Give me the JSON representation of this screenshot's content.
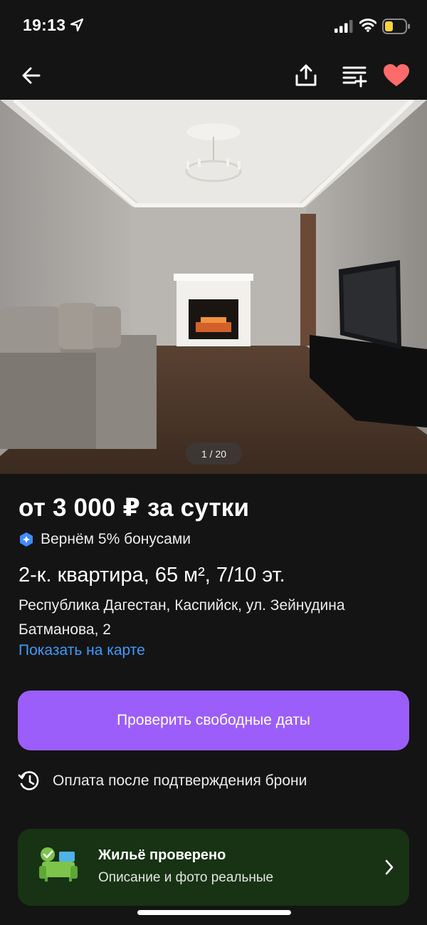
{
  "status": {
    "time": "19:13"
  },
  "gallery": {
    "counter": "1 / 20"
  },
  "listing": {
    "price": "от 3 000 ₽ за сутки",
    "bonus": "Вернём 5% бонусами",
    "title": "2-к. квартира, 65 м², 7/10 эт.",
    "address": "Республика Дагестан, Каспийск, ул. Зейнудина Батманова, 2",
    "map_link": "Показать на карте"
  },
  "cta": {
    "label": "Проверить свободные даты"
  },
  "payment": {
    "text": "Оплата после подтверждения брони"
  },
  "verified": {
    "title": "Жильё проверено",
    "subtitle": "Описание и фото реальные"
  },
  "colors": {
    "background": "#141414",
    "accent": "#9c5efa",
    "link": "#3d9bff",
    "favorite": "#ff6b6b",
    "verified_bg": "#173313",
    "bonus_icon": "#3d8bff"
  },
  "icons": {
    "nav": [
      "back-arrow-icon",
      "share-icon",
      "compare-list-icon",
      "heart-icon"
    ],
    "bonus": "bonus-badge-icon",
    "payment": "history-clock-icon",
    "verified": "verified-sofa-icon"
  }
}
